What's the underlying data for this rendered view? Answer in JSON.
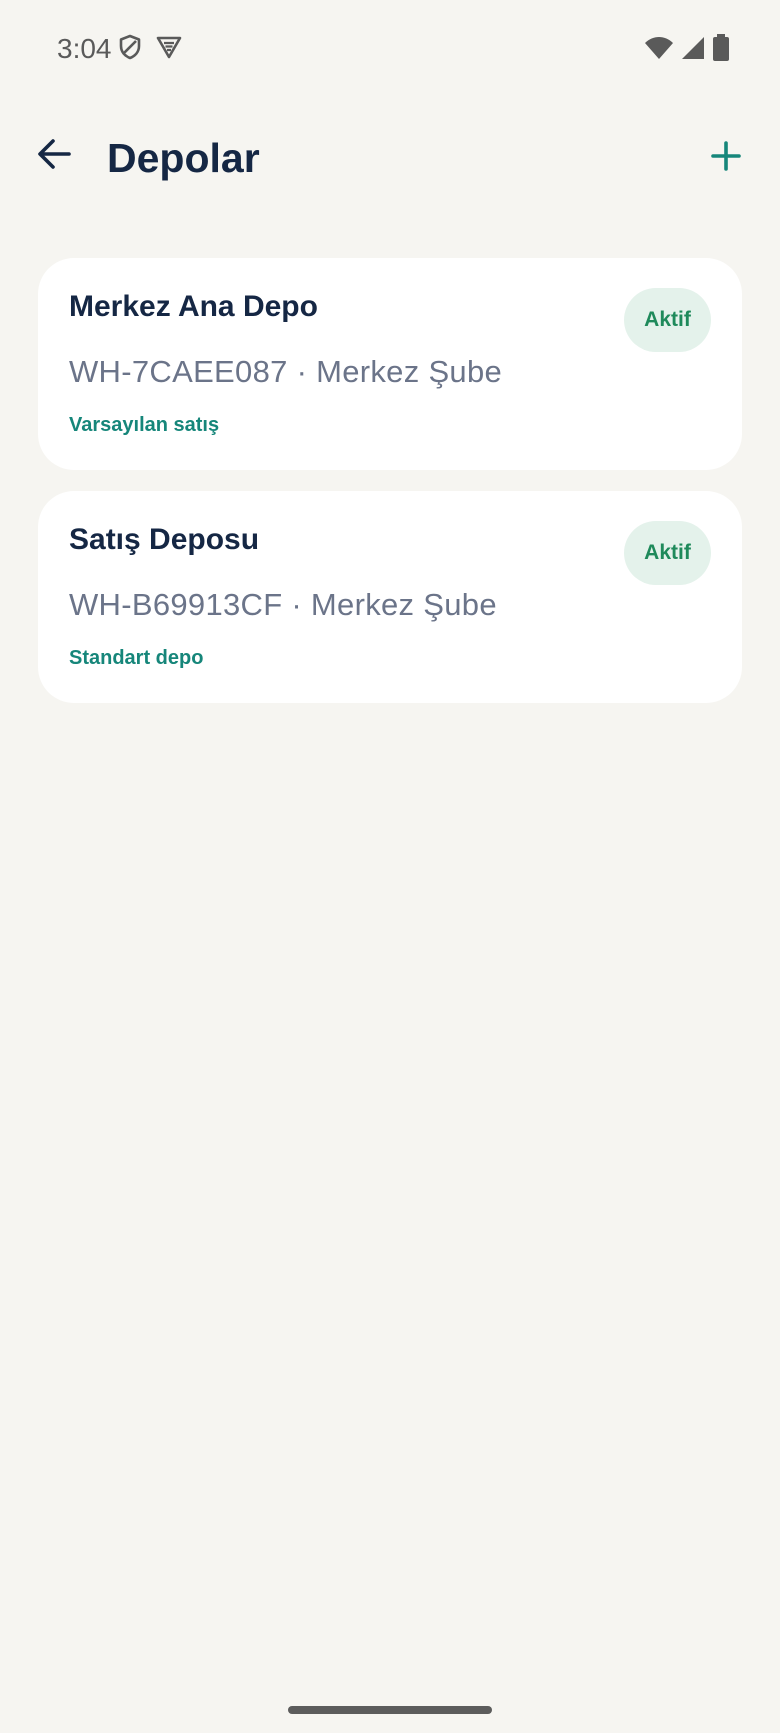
{
  "status_bar": {
    "time": "3:04"
  },
  "header": {
    "title": "Depolar"
  },
  "warehouses": [
    {
      "name": "Merkez Ana Depo",
      "code_branch": "WH-7CAEE087 · Merkez Şube",
      "tag": "Varsayılan satış",
      "status": "Aktif"
    },
    {
      "name": "Satış Deposu",
      "code_branch": "WH-B69913CF · Merkez Şube",
      "tag": "Standart depo",
      "status": "Aktif"
    }
  ],
  "icons": {
    "back": "arrow-back-icon",
    "add": "plus-icon",
    "wifi": "wifi-icon",
    "signal": "signal-icon",
    "battery": "battery-icon"
  },
  "colors": {
    "background": "#f6f5f1",
    "title": "#152744",
    "accent": "#16867a",
    "badge_bg": "#e4f2eb",
    "badge_text": "#1f8a5b",
    "meta_text": "#6b7489"
  }
}
